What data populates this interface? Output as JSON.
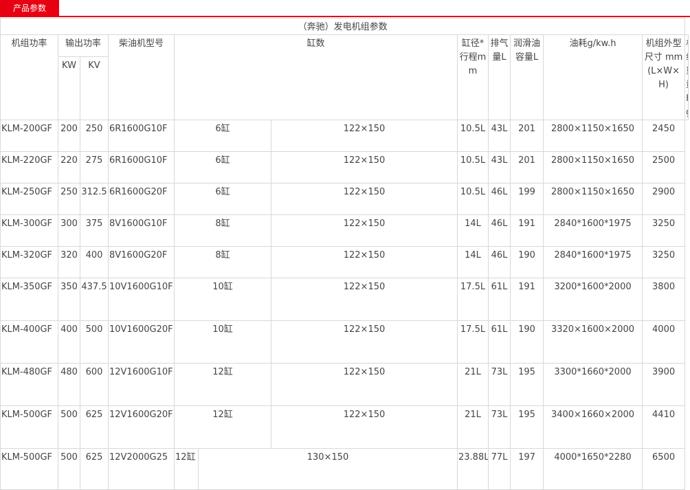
{
  "tab": {
    "label": "产品参数"
  },
  "table": {
    "caption": "（奔驰）发电机组参数",
    "headers": {
      "power": "机组功率",
      "output": "输出功率",
      "kw": "KW",
      "kv": "KV",
      "engine": "柴油机型号",
      "cylinders": "缸数",
      "bore": "缸径*行程mm",
      "displacement": "排气量L",
      "lube": "润滑油容量L",
      "fuel": "油耗g/kw.h",
      "dims": "机组外型 尺寸 mm (L×W×H)",
      "weight": "机组重量Kg"
    },
    "rows": [
      {
        "model": "KLM-200GF",
        "kw": "200",
        "kv": "250",
        "engine": "6R1600G10F",
        "cyl": "6缸",
        "bore": "122×150",
        "disp": "10.5L",
        "lube": "43L",
        "fuel": "201",
        "dims": "2800×1150×1650",
        "weight": "2450"
      },
      {
        "model": "KLM-220GF",
        "kw": "220",
        "kv": "275",
        "engine": "6R1600G10F",
        "cyl": "6缸",
        "bore": "122×150",
        "disp": "10.5L",
        "lube": "43L",
        "fuel": "201",
        "dims": "2800×1150×1650",
        "weight": "2500"
      },
      {
        "model": "KLM-250GF",
        "kw": "250",
        "kv": "312.5",
        "engine": "6R1600G20F",
        "cyl": "6缸",
        "bore": "122×150",
        "disp": "10.5L",
        "lube": "46L",
        "fuel": "199",
        "dims": "2800×1150×1650",
        "weight": "2900"
      },
      {
        "model": "KLM-300GF",
        "kw": "300",
        "kv": "375",
        "engine": "8V1600G10F",
        "cyl": "8缸",
        "bore": "122×150",
        "disp": "14L",
        "lube": "46L",
        "fuel": "191",
        "dims": "2840*1600*1975",
        "weight": "3250"
      },
      {
        "model": "KLM-320GF",
        "kw": "320",
        "kv": "400",
        "engine": "8V1600G20F",
        "cyl": "8缸",
        "bore": "122×150",
        "disp": "14L",
        "lube": "46L",
        "fuel": "190",
        "dims": "2840*1600*1975",
        "weight": "3250"
      },
      {
        "model": "KLM-350GF",
        "kw": "350",
        "kv": "437.5",
        "engine": "10V1600G10F",
        "cyl": "10缸",
        "bore": "122×150",
        "disp": "17.5L",
        "lube": "61L",
        "fuel": "191",
        "dims": "3200*1600*2000",
        "weight": "3800"
      },
      {
        "model": "KLM-400GF",
        "kw": "400",
        "kv": "500",
        "engine": "10V1600G20F",
        "cyl": "10缸",
        "bore": "122×150",
        "disp": "17.5L",
        "lube": "61L",
        "fuel": "190",
        "dims": "3320×1600×2000",
        "weight": "4000"
      },
      {
        "model": "KLM-480GF",
        "kw": "480",
        "kv": "600",
        "engine": "12V1600G10F",
        "cyl": "12缸",
        "bore": "122×150",
        "disp": "21L",
        "lube": "73L",
        "fuel": "195",
        "dims": "3300*1660*2000",
        "weight": "3900"
      },
      {
        "model": "KLM-500GF",
        "kw": "500",
        "kv": "625",
        "engine": "12V1600G20F",
        "cyl": "12缸",
        "bore": "122×150",
        "disp": "21L",
        "lube": "73L",
        "fuel": "195",
        "dims": "3400×1660×2000",
        "weight": "4410"
      },
      {
        "model": "KLM-500GF",
        "kw": "500",
        "kv": "625",
        "engine": "12V2000G25",
        "cyl": "12缸",
        "bore": "130×150",
        "disp": "23.88L",
        "lube": "77L",
        "fuel": "197",
        "dims": "4000*1650*2280",
        "weight": "6500"
      }
    ]
  },
  "colors": {
    "accent": "#e60012",
    "border": "#d8d8d8",
    "text": "#444444"
  }
}
